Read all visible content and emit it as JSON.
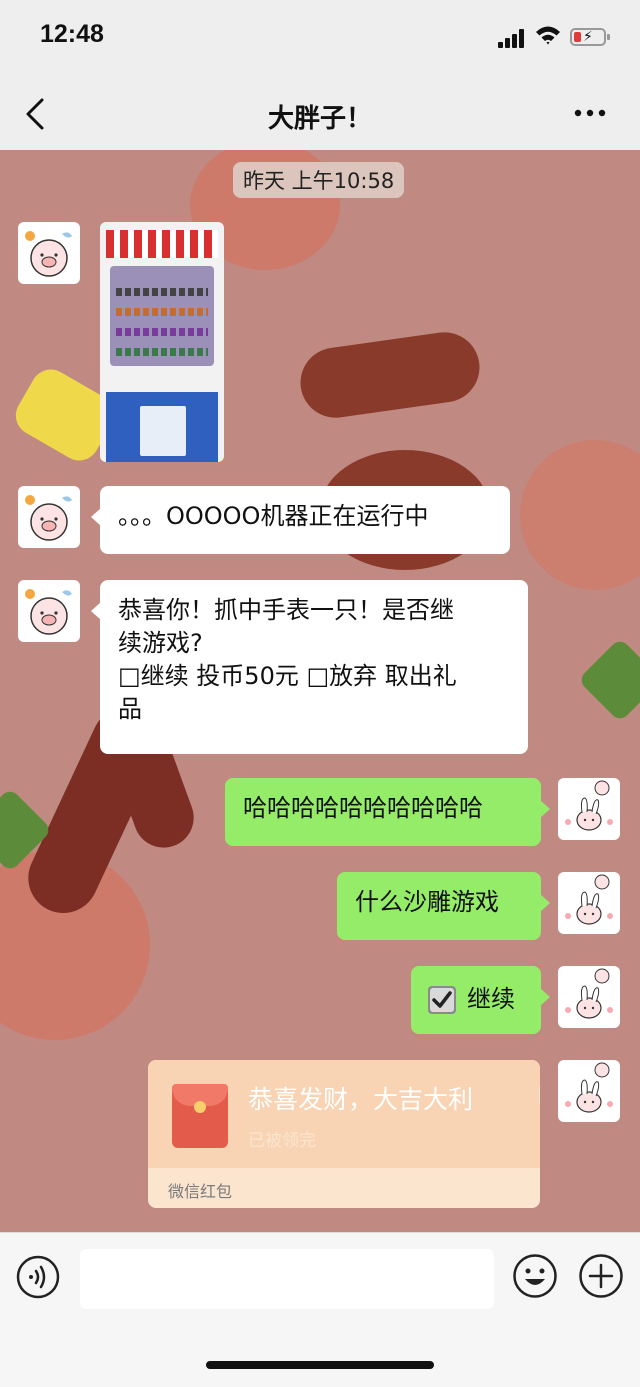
{
  "status_bar": {
    "time": "12:48"
  },
  "header": {
    "title": "大胖子！"
  },
  "chat": {
    "timestamp": "昨天 上午10:58",
    "messages": [
      {
        "side": "left",
        "type": "image"
      },
      {
        "side": "left",
        "type": "text",
        "lines": [
          "。。。OOOOO机器正在运行中"
        ]
      },
      {
        "side": "left",
        "type": "text",
        "lines": [
          "恭喜你！抓中手表一只！是否继",
          "续游戏?",
          "□继续 投币50元  □放弃 取出礼",
          "品"
        ]
      },
      {
        "side": "right",
        "type": "text",
        "lines": [
          "哈哈哈哈哈哈哈哈哈哈"
        ]
      },
      {
        "side": "right",
        "type": "text",
        "lines": [
          "什么沙雕游戏"
        ]
      },
      {
        "side": "right",
        "type": "text",
        "lines": [
          "继续"
        ]
      },
      {
        "side": "right",
        "type": "red_packet",
        "title": "恭喜发财，大吉大利",
        "status": "已被领完",
        "footer": "微信红包"
      }
    ]
  },
  "colors": {
    "chat_bg": "#c08a82",
    "bubble_sent": "#95ec69",
    "bubble_received": "#ffffff",
    "red_packet": "#f8d4b4"
  }
}
